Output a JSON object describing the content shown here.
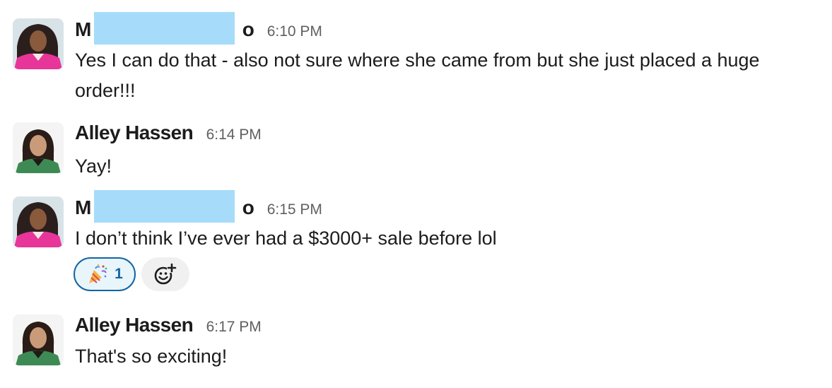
{
  "messages": [
    {
      "name_start": "M",
      "name_end": "o",
      "time": "6:10 PM",
      "text": "Yes I can do that - also not sure where she came from but she just placed a huge order!!!"
    },
    {
      "name": "Alley Hassen",
      "time": "6:14 PM",
      "text": "Yay!"
    },
    {
      "name_start": "M",
      "name_end": "o",
      "time": "6:15 PM",
      "text": "I don’t think I’ve ever had a $3000+ sale before lol",
      "reaction": {
        "emoji": "party-popper-icon",
        "count": "1"
      }
    },
    {
      "name": "Alley Hassen",
      "time": "6:17 PM",
      "text": "That's so exciting!"
    }
  ],
  "colors": {
    "redaction": "#a6dcf9",
    "reaction_border": "#1264a3",
    "reaction_bg": "#e8f5fa",
    "timestamp": "#616061"
  }
}
